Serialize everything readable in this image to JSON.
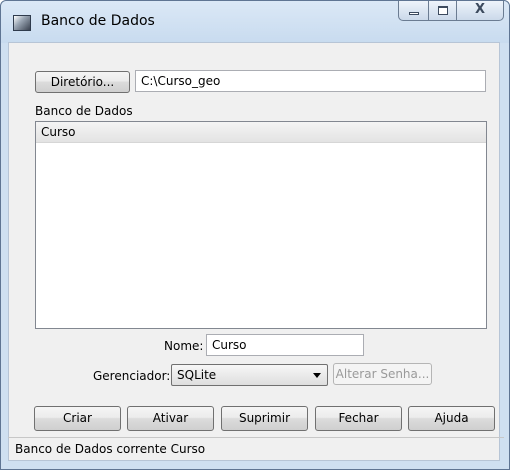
{
  "window": {
    "title": "Banco de Dados",
    "icon": "database-app-icon",
    "controls": {
      "minimize": "minimize-icon",
      "maximize": "maximize-icon",
      "close_glyph": "X"
    }
  },
  "directory": {
    "button_label": "Diretório...",
    "path": "C:\\Curso_geo"
  },
  "databases": {
    "label": "Banco de Dados",
    "items": [
      "Curso"
    ],
    "selected": "Curso"
  },
  "name": {
    "label": "Nome:",
    "value": "Curso"
  },
  "manager": {
    "label": "Gerenciador:",
    "selected": "SQLite",
    "change_password_label": "Alterar Senha..."
  },
  "actions": {
    "create": "Criar",
    "activate": "Ativar",
    "delete": "Suprimir",
    "close": "Fechar",
    "help": "Ajuda"
  },
  "status": {
    "text": "Banco de Dados corrente Curso"
  }
}
